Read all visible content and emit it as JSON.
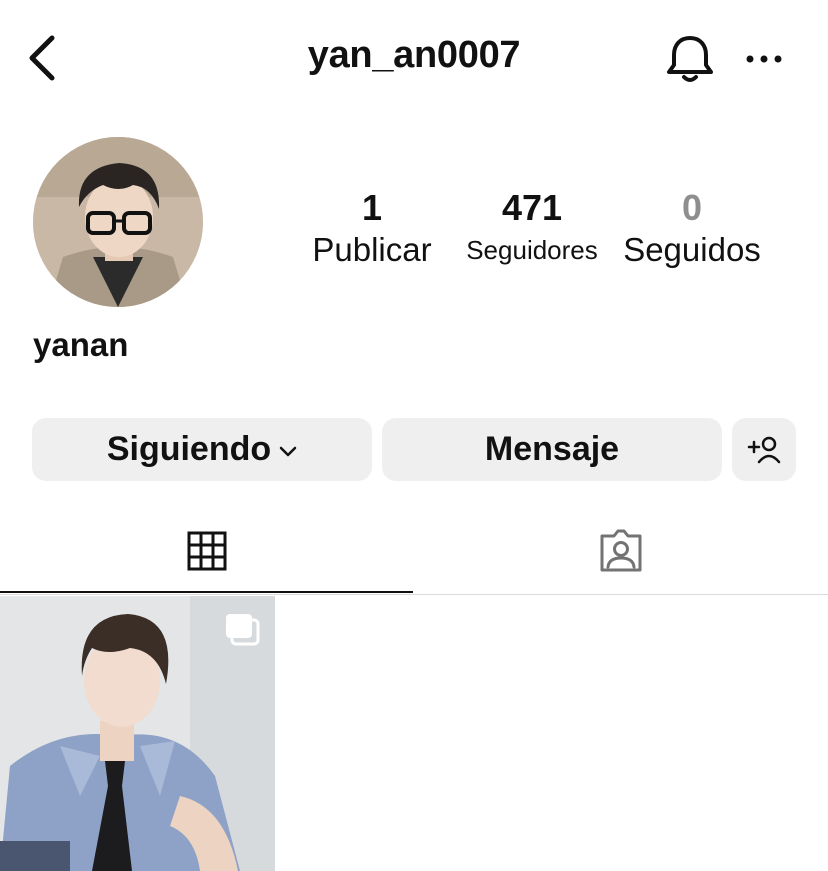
{
  "header": {
    "username": "yan_an0007",
    "icons": {
      "back": "chevron-left-icon",
      "notifications": "bell-icon",
      "more": "more-horizontal-icon"
    }
  },
  "profile": {
    "display_name": "yanan",
    "stats": [
      {
        "value": "1",
        "label": "Publicar"
      },
      {
        "value": "471",
        "label": "Seguidores"
      },
      {
        "value": "0",
        "label": "Seguidos"
      }
    ]
  },
  "actions": {
    "following_label": "Siguiendo",
    "message_label": "Mensaje",
    "suggest_icon": "add-person-icon"
  },
  "tabs": [
    {
      "icon": "grid-icon",
      "active": true
    },
    {
      "icon": "tagged-person-icon",
      "active": false
    }
  ],
  "posts": [
    {
      "type": "carousel",
      "icon": "multiple-photos-icon"
    }
  ],
  "colors": {
    "text": "#111111",
    "muted": "#8e8e8e",
    "button_bg": "#efefef",
    "divider": "#dbdbdb"
  }
}
